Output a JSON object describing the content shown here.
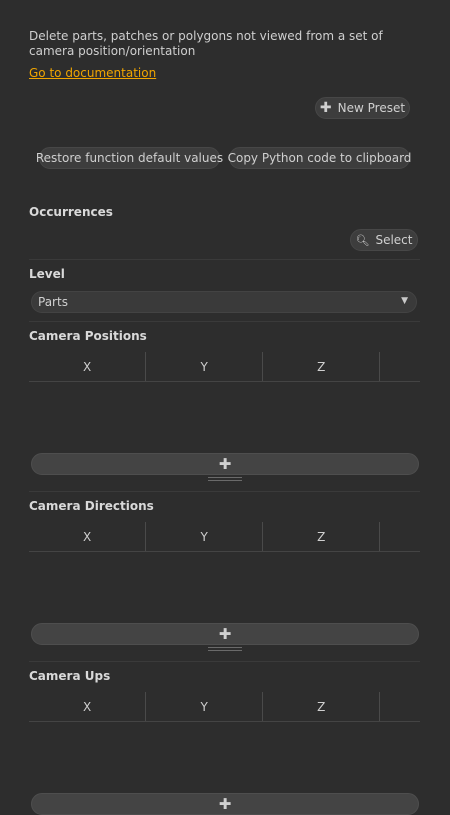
{
  "description": "Delete parts, patches or polygons not viewed from a set of camera position/orientation",
  "doc_link": "Go to documentation",
  "toolbar": {
    "new_preset": "New Preset",
    "restore_defaults": "Restore function default values",
    "copy_python": "Copy Python code to clipboard"
  },
  "occurrences": {
    "title": "Occurrences",
    "select_label": "Select"
  },
  "level": {
    "title": "Level",
    "selected": "Parts"
  },
  "camera_positions": {
    "title": "Camera Positions",
    "columns": [
      "X",
      "Y",
      "Z"
    ]
  },
  "camera_directions": {
    "title": "Camera Directions",
    "columns": [
      "X",
      "Y",
      "Z"
    ]
  },
  "camera_ups": {
    "title": "Camera Ups",
    "columns": [
      "X",
      "Y",
      "Z"
    ]
  },
  "icons": {
    "add": "plus-icon",
    "search": "search-icon",
    "dropdown": "chevron-down-icon"
  },
  "colors": {
    "background": "#2d2d2d",
    "link": "#f0a500",
    "pill": "#3d3d3d"
  }
}
